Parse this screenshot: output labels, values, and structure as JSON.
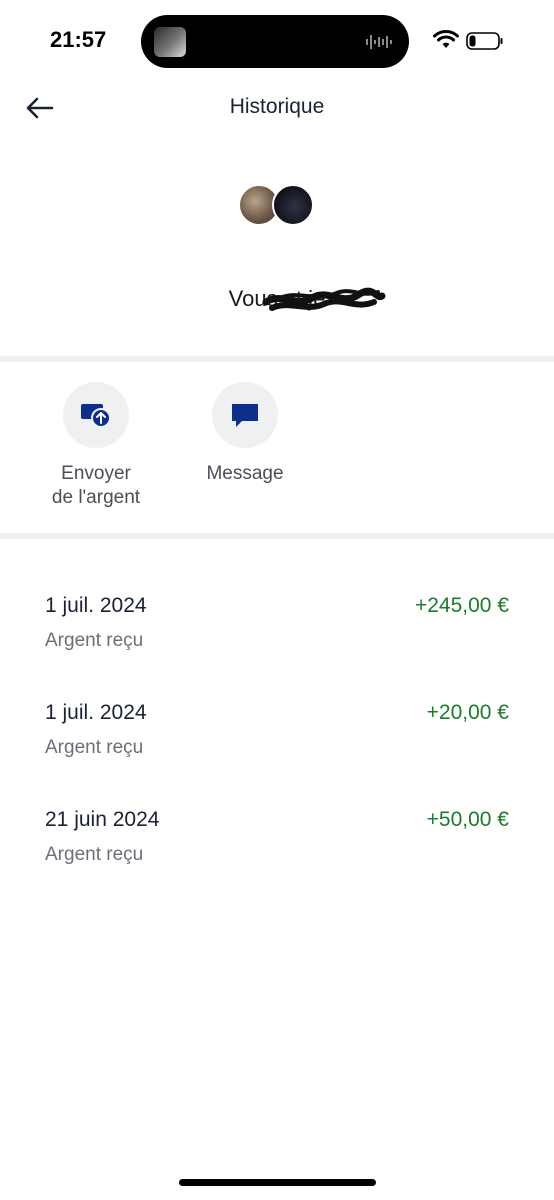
{
  "status_bar": {
    "time": "21:57",
    "icons": [
      "wifi-icon",
      "battery-icon"
    ]
  },
  "header": {
    "title": "Historique",
    "back_icon": "arrow-left-icon"
  },
  "contact": {
    "name": "Vous et je"
  },
  "actions": [
    {
      "label": "Envoyer\nde l'argent",
      "icon": "send-money-icon",
      "color": "#0b2f8a"
    },
    {
      "label": "Message",
      "icon": "chat-bubble-icon",
      "color": "#0b2f8a"
    }
  ],
  "transactions": [
    {
      "date": "1 juil. 2024",
      "type": "Argent reçu",
      "amount": "+245,00 €"
    },
    {
      "date": "1 juil. 2024",
      "type": "Argent reçu",
      "amount": "+20,00 €"
    },
    {
      "date": "21 juin 2024",
      "type": "Argent reçu",
      "amount": "+50,00 €"
    }
  ],
  "colors": {
    "positive_amount": "#1d7a2f",
    "icon_accent": "#0b2f8a",
    "action_bg": "#eef0f2"
  }
}
